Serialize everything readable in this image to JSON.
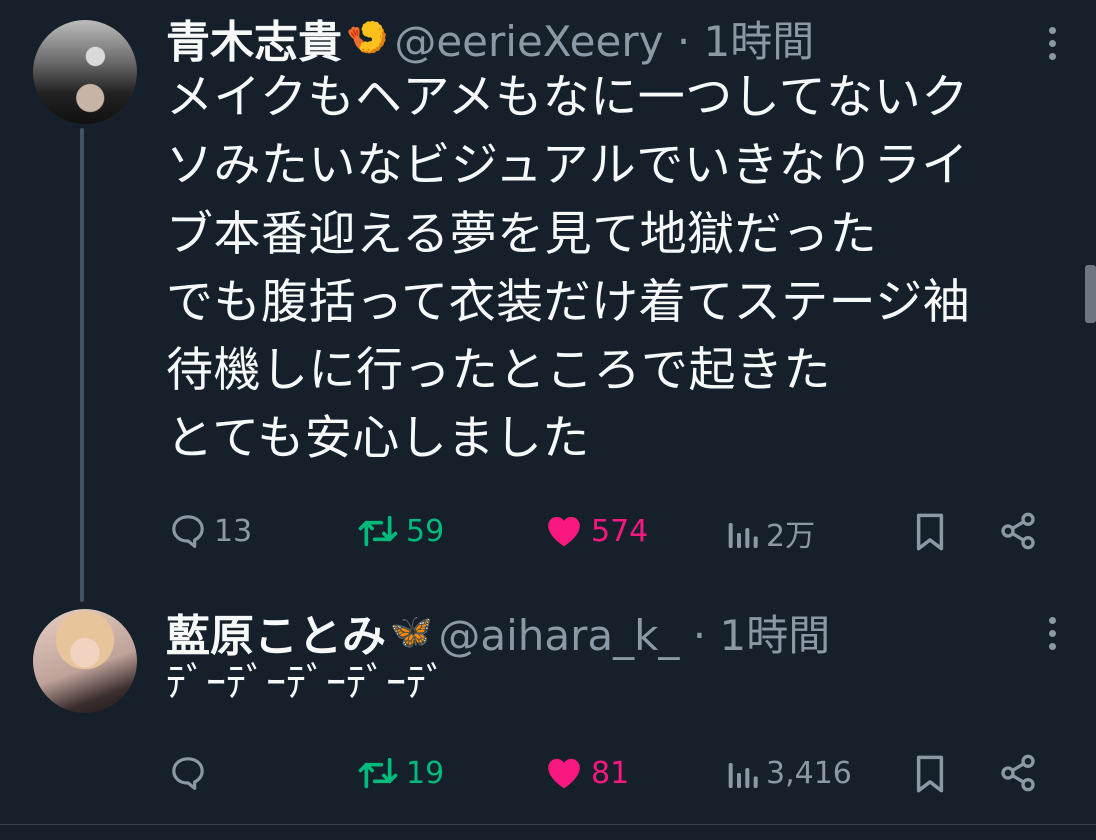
{
  "tweets": [
    {
      "name": "青木志貴",
      "badge": "🍤",
      "handle": "@eerieXeery · 1時間",
      "lines": [
        "メイクもヘアメもなに一つしてないク",
        "ソみたいなビジュアルでいきなりライ",
        "ブ本番迎える夢を見て地獄だった",
        "でも腹括って衣装だけ着てステージ袖",
        "待機しに行ったところで起きた",
        "とても安心しました"
      ],
      "replies": "13",
      "retweets": "59",
      "likes": "574",
      "views": "2万"
    },
    {
      "name": "藍原ことみ",
      "badge": "🦋",
      "handle": "@aihara_k_ · 1時間",
      "text": "ﾃﾞｰﾃﾞｰﾃﾞｰﾃﾞｰﾃﾞ",
      "replies": "",
      "retweets": "19",
      "likes": "81",
      "views": "3,416"
    }
  ],
  "icons": [
    "reply-icon",
    "retweet-icon",
    "heart-icon",
    "views-icon",
    "bookmark-icon",
    "share-icon",
    "more-icon"
  ],
  "colors": {
    "background": "#15202b",
    "text": "#f7f9f9",
    "muted": "#8b98a5",
    "retweet": "#00ba7c",
    "like": "#f91880"
  }
}
